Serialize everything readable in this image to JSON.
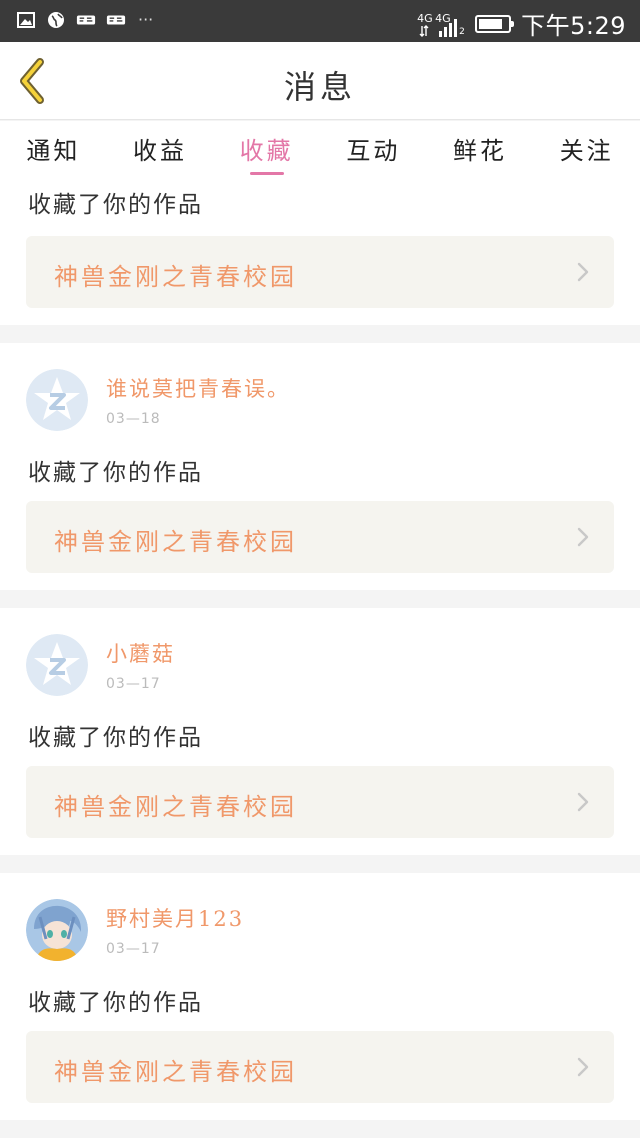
{
  "status_bar": {
    "net_left": "4G",
    "net_right": "4G",
    "sim_index": "2",
    "dots": "···",
    "battery_level": 0.85,
    "time": "下午5:29"
  },
  "header": {
    "title": "消息"
  },
  "tabs": [
    {
      "label": "通知",
      "active": false
    },
    {
      "label": "收益",
      "active": false
    },
    {
      "label": "收藏",
      "active": true
    },
    {
      "label": "互动",
      "active": false
    },
    {
      "label": "鲜花",
      "active": false
    },
    {
      "label": "关注",
      "active": false
    }
  ],
  "feed": [
    {
      "action": "收藏了你的作品",
      "work_title": "神兽金刚之青春校园"
    },
    {
      "username": "谁说莫把青春误。",
      "date": "03—18",
      "avatar": "default-avatar-icon",
      "action": "收藏了你的作品",
      "work_title": "神兽金刚之青春校园"
    },
    {
      "username": "小蘑菇",
      "date": "03—17",
      "avatar": "default-avatar-icon",
      "action": "收藏了你的作品",
      "work_title": "神兽金刚之青春校园"
    },
    {
      "username": "野村美月123",
      "date": "03—17",
      "avatar": "anime-avatar",
      "action": "收藏了你的作品",
      "work_title": "神兽金刚之青春校园"
    }
  ],
  "colors": {
    "accent_pink": "#e377a7",
    "orange_text": "#f0986a",
    "card_bg": "#f5f4ef"
  }
}
